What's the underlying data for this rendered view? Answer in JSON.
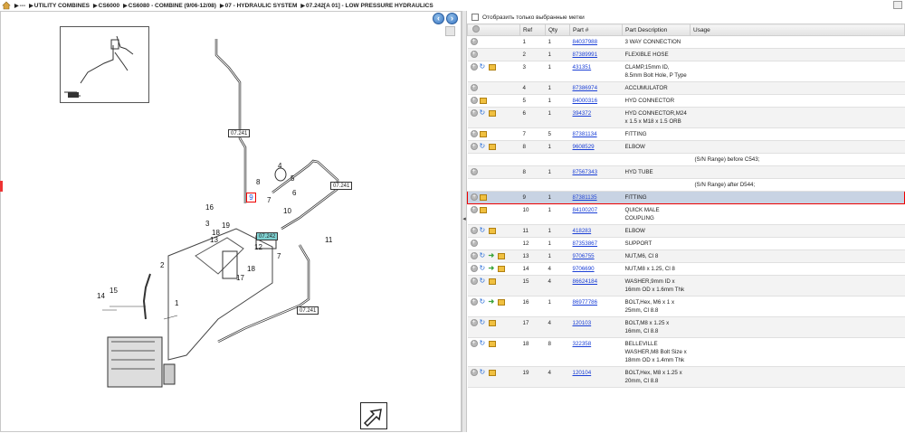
{
  "breadcrumb": {
    "items": [
      "---",
      "UTILITY COMBINES",
      "CS6000",
      "CS6080 - COMBINE (9/06-12/08)",
      "07 - HYDRAULIC SYSTEM",
      "07.242[A 01] - LOW PRESSURE HYDRAULICS"
    ]
  },
  "drawing": {
    "callouts": [
      "07.241",
      "07.241",
      "07.241",
      "07.242"
    ],
    "item_numbers": [
      "1",
      "2",
      "3",
      "4",
      "5",
      "6",
      "7",
      "7",
      "8",
      "9",
      "10",
      "11",
      "12",
      "13",
      "14",
      "15",
      "16",
      "17",
      "18",
      "18",
      "19"
    ]
  },
  "filter": {
    "label": "Отобразить только выбранные метки"
  },
  "table": {
    "headers": {
      "ref": "Ref",
      "qty": "Qty",
      "part": "Part #",
      "desc": "Part Description",
      "usage": "Usage"
    },
    "rows": [
      {
        "type": "part",
        "icons": [
          "plus"
        ],
        "ref": "1",
        "qty": "1",
        "part": "84037988",
        "desc": "3 WAY CONNECTION"
      },
      {
        "type": "part",
        "icons": [
          "plus"
        ],
        "ref": "2",
        "qty": "1",
        "part": "87389991",
        "desc": "FLEXIBLE HOSE"
      },
      {
        "type": "part",
        "icons": [
          "plus",
          "cycle",
          "box"
        ],
        "ref": "3",
        "qty": "1",
        "part": "431351",
        "desc": "CLAMP,15mm ID, 8.5mm Bolt Hole, P Type"
      },
      {
        "type": "part",
        "icons": [
          "plus"
        ],
        "ref": "4",
        "qty": "1",
        "part": "87386974",
        "desc": "ACCUMULATOR"
      },
      {
        "type": "part",
        "icons": [
          "plus",
          "box"
        ],
        "ref": "5",
        "qty": "1",
        "part": "84000316",
        "desc": "HYD CONNECTOR"
      },
      {
        "type": "part",
        "icons": [
          "plus",
          "cycle",
          "box"
        ],
        "ref": "6",
        "qty": "1",
        "part": "394372",
        "desc": "HYD CONNECTOR,M24 x 1.5  x M18 x 1.5 ORB"
      },
      {
        "type": "part",
        "icons": [
          "plus",
          "box"
        ],
        "ref": "7",
        "qty": "5",
        "part": "87381134",
        "desc": "FITTING"
      },
      {
        "type": "part",
        "icons": [
          "plus",
          "cycle",
          "box"
        ],
        "ref": "8",
        "qty": "1",
        "part": "9608529",
        "desc": "ELBOW"
      },
      {
        "type": "note",
        "text": "(S/N Range) before C543;"
      },
      {
        "type": "part",
        "icons": [
          "plus"
        ],
        "ref": "8",
        "qty": "1",
        "part": "87567343",
        "desc": "HYD TUBE"
      },
      {
        "type": "note",
        "text": "(S/N Range) after D544;"
      },
      {
        "type": "part",
        "icons": [
          "plus",
          "box"
        ],
        "ref": "9",
        "qty": "1",
        "part": "87381135",
        "desc": "FITTING",
        "selected": true
      },
      {
        "type": "part",
        "icons": [
          "plus",
          "box"
        ],
        "ref": "10",
        "qty": "1",
        "part": "84100207",
        "desc": "QUICK MALE COUPLING"
      },
      {
        "type": "part",
        "icons": [
          "plus",
          "cycle",
          "box"
        ],
        "ref": "11",
        "qty": "1",
        "part": "418283",
        "desc": "ELBOW"
      },
      {
        "type": "part",
        "icons": [
          "plus"
        ],
        "ref": "12",
        "qty": "1",
        "part": "87353867",
        "desc": "SUPPORT"
      },
      {
        "type": "part",
        "icons": [
          "plus",
          "cycle",
          "green",
          "box"
        ],
        "ref": "13",
        "qty": "1",
        "part": "9706755",
        "desc": "NUT,M6, Cl 8"
      },
      {
        "type": "part",
        "icons": [
          "plus",
          "cycle",
          "green",
          "box"
        ],
        "ref": "14",
        "qty": "4",
        "part": "9706690",
        "desc": "NUT,M8 x 1.25, Cl 8"
      },
      {
        "type": "part",
        "icons": [
          "plus",
          "cycle",
          "box"
        ],
        "ref": "15",
        "qty": "4",
        "part": "86624184",
        "desc": "WASHER,9mm ID x 16mm OD x 1.6mm Thk"
      },
      {
        "type": "part",
        "icons": [
          "plus",
          "cycle",
          "green",
          "box"
        ],
        "ref": "16",
        "qty": "1",
        "part": "86977786",
        "desc": "BOLT,Hex, M6 x 1 x 25mm, Cl 8.8"
      },
      {
        "type": "part",
        "icons": [
          "plus",
          "cycle",
          "box"
        ],
        "ref": "17",
        "qty": "4",
        "part": "120103",
        "desc": "BOLT,M8 x 1.25 x 16mm, Cl 8.8"
      },
      {
        "type": "part",
        "icons": [
          "plus",
          "cycle",
          "box"
        ],
        "ref": "18",
        "qty": "8",
        "part": "322358",
        "desc": "BELLEVILLE WASHER,M8 Bolt Size x 18mm OD x 1.4mm Thk"
      },
      {
        "type": "part",
        "icons": [
          "plus",
          "cycle",
          "box"
        ],
        "ref": "19",
        "qty": "4",
        "part": "120104",
        "desc": "BOLT,Hex, M8 x 1.25 x 20mm, Cl 8.8"
      }
    ]
  },
  "colors": {
    "link": "#1a3fd6",
    "selected_border": "#e00000",
    "selected_bg": "#c8d3e3",
    "callout_highlight": "#7fd3d3"
  }
}
